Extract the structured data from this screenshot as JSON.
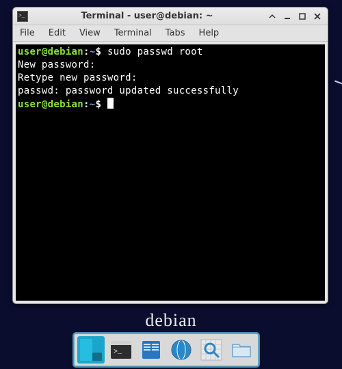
{
  "window": {
    "title": "Terminal - user@debian: ~",
    "icon_glyph": ">_"
  },
  "menubar": {
    "items": [
      {
        "label": "File"
      },
      {
        "label": "Edit"
      },
      {
        "label": "View"
      },
      {
        "label": "Terminal"
      },
      {
        "label": "Tabs"
      },
      {
        "label": "Help"
      }
    ]
  },
  "terminal": {
    "prompt_user": "user@debian",
    "prompt_sep": ":",
    "prompt_path": "~",
    "prompt_sym": "$",
    "lines": [
      {
        "type": "cmd",
        "text": "sudo passwd root"
      },
      {
        "type": "out",
        "text": "New password:"
      },
      {
        "type": "out",
        "text": "Retype new password:"
      },
      {
        "type": "out",
        "text": "passwd: password updated successfully"
      },
      {
        "type": "cmd",
        "text": ""
      }
    ]
  },
  "desktop": {
    "brand": "debian"
  },
  "panel": {
    "items": [
      {
        "name": "show-desktop",
        "active": true
      },
      {
        "name": "terminal-launcher",
        "active": false
      },
      {
        "name": "file-manager-launcher",
        "active": false
      },
      {
        "name": "web-browser-launcher",
        "active": false
      },
      {
        "name": "search-launcher",
        "active": false
      },
      {
        "name": "folder-launcher",
        "active": false
      }
    ]
  },
  "colors": {
    "desktop_bg": "#0a0d2e",
    "term_bg": "#000000",
    "term_fg": "#ffffff",
    "prompt_user": "#8ae234",
    "prompt_path": "#729fcf",
    "panel_accent": "#5fb3d4"
  }
}
